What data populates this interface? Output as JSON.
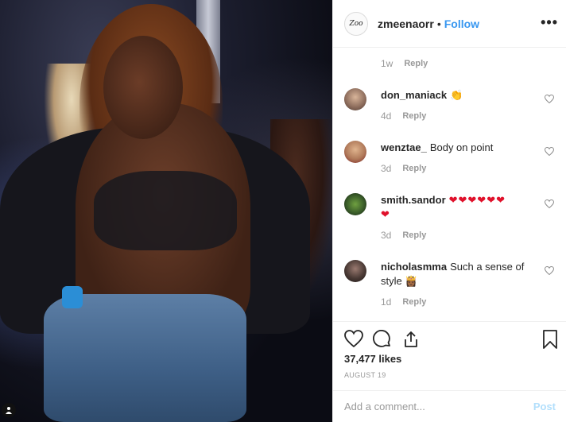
{
  "post": {
    "username": "zmeenaorr",
    "separator": "•",
    "follow_label": "Follow",
    "more_label": "•••",
    "avatar_text": "Zoo",
    "photo_user_tag_icon": "user-tag-icon"
  },
  "top_meta": {
    "time": "1w",
    "reply_label": "Reply"
  },
  "comments": [
    {
      "user": "don_maniack",
      "text": "👏",
      "time": "4d",
      "reply": "Reply",
      "avatar_color": "#8a6a5a"
    },
    {
      "user": "wenztae_",
      "text": "Body on point",
      "time": "3d",
      "reply": "Reply",
      "avatar_color": "#b07a5a"
    },
    {
      "user": "smith.sandor",
      "text": "❤❤❤❤❤❤",
      "text2": "❤",
      "time": "3d",
      "reply": "Reply",
      "avatar_color": "#3b5e2a"
    },
    {
      "user": "nicholasmma",
      "text": "Such a sense of style 👸🏾",
      "time": "1d",
      "reply": "Reply",
      "avatar_color": "#4a3a35"
    }
  ],
  "likes": "37,477 likes",
  "date": "AUGUST 19",
  "add_comment": {
    "placeholder": "Add a comment...",
    "post_label": "Post"
  },
  "colors": {
    "accent": "#3897f0",
    "heart": "#e0112b",
    "muted": "#999999",
    "post_disabled": "#b2dffc"
  }
}
